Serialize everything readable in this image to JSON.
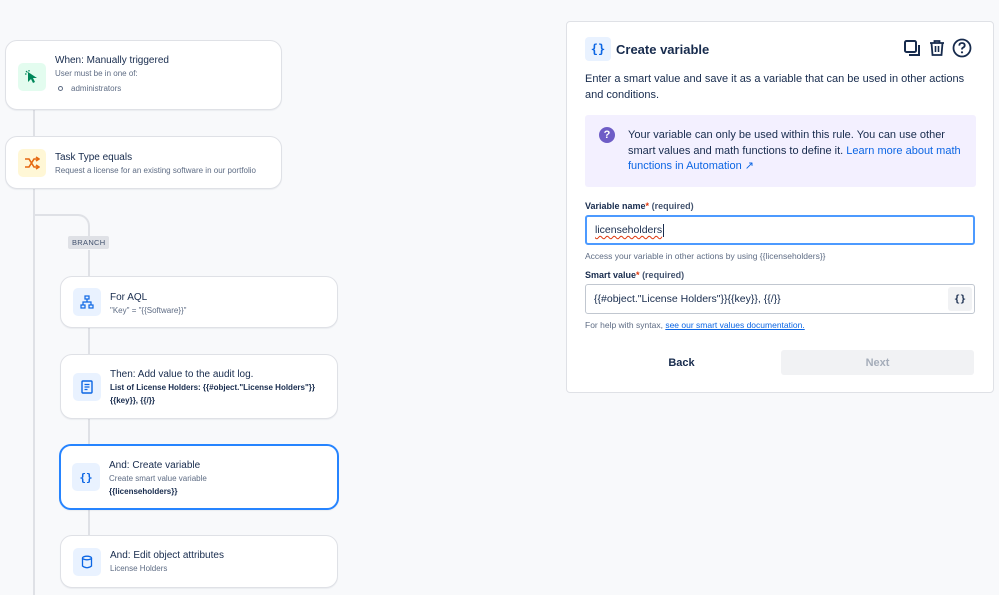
{
  "flow": {
    "trigger": {
      "title": "When: Manually triggered",
      "subtitle": "User must be in one of:",
      "bullet": "administrators"
    },
    "condition": {
      "title": "Task Type equals",
      "subtitle": "Request a license for an existing software in our portfolio"
    },
    "branch_label": "BRANCH",
    "for_aql": {
      "title": "For AQL",
      "subtitle": "\"Key\" = \"{{Software}}\""
    },
    "audit_log": {
      "title": "Then: Add value to the audit log.",
      "line1": "List of License Holders: {{#object.\"License Holders\"}}",
      "line2": "{{key}}, {{/}}"
    },
    "create_variable": {
      "title": "And: Create variable",
      "subtitle": "Create smart value variable",
      "value": "{{licenseholders}}"
    },
    "edit_attributes": {
      "title": "And: Edit object attributes",
      "subtitle": "License Holders"
    }
  },
  "panel": {
    "icon_text": "{}",
    "title": "Create variable",
    "description": "Enter a smart value and save it as a variable that can be used in other actions and conditions.",
    "info_text": "Your variable can only be used within this rule. You can use other smart values and math functions to define it. ",
    "info_link": "Learn more about math functions in Automation ↗",
    "variable_name": {
      "label": "Variable name",
      "required_mark": "*",
      "hint": "(required)",
      "value": "licenseholders",
      "help": "Access your variable in other actions by using {{licenseholders}}"
    },
    "smart_value": {
      "label": "Smart value",
      "required_mark": "*",
      "hint": "(required)",
      "value": "{{#object.\"License Holders\"}}{{key}}, {{/}}",
      "button": "{}",
      "help_prefix": "For help with syntax,",
      "help_link": "see our smart values documentation."
    },
    "back_label": "Back",
    "next_label": "Next"
  },
  "colors": {
    "accent": "#0c66e4",
    "selected_border": "#2684ff",
    "info_bg": "#f3f0ff",
    "trigger_icon_bg": "#e3fcef",
    "condition_icon_bg": "#fff7d6",
    "action_icon_bg": "#e9f2ff"
  },
  "icons": {
    "trigger": "cursor-click-icon",
    "condition": "shuffle-icon",
    "for_aql": "hierarchy-icon",
    "audit_log": "document-icon",
    "create_variable": "braces-icon",
    "edit_attributes": "database-icon",
    "copy": "copy-icon",
    "delete": "trash-icon",
    "help": "help-icon",
    "info": "question-icon"
  }
}
